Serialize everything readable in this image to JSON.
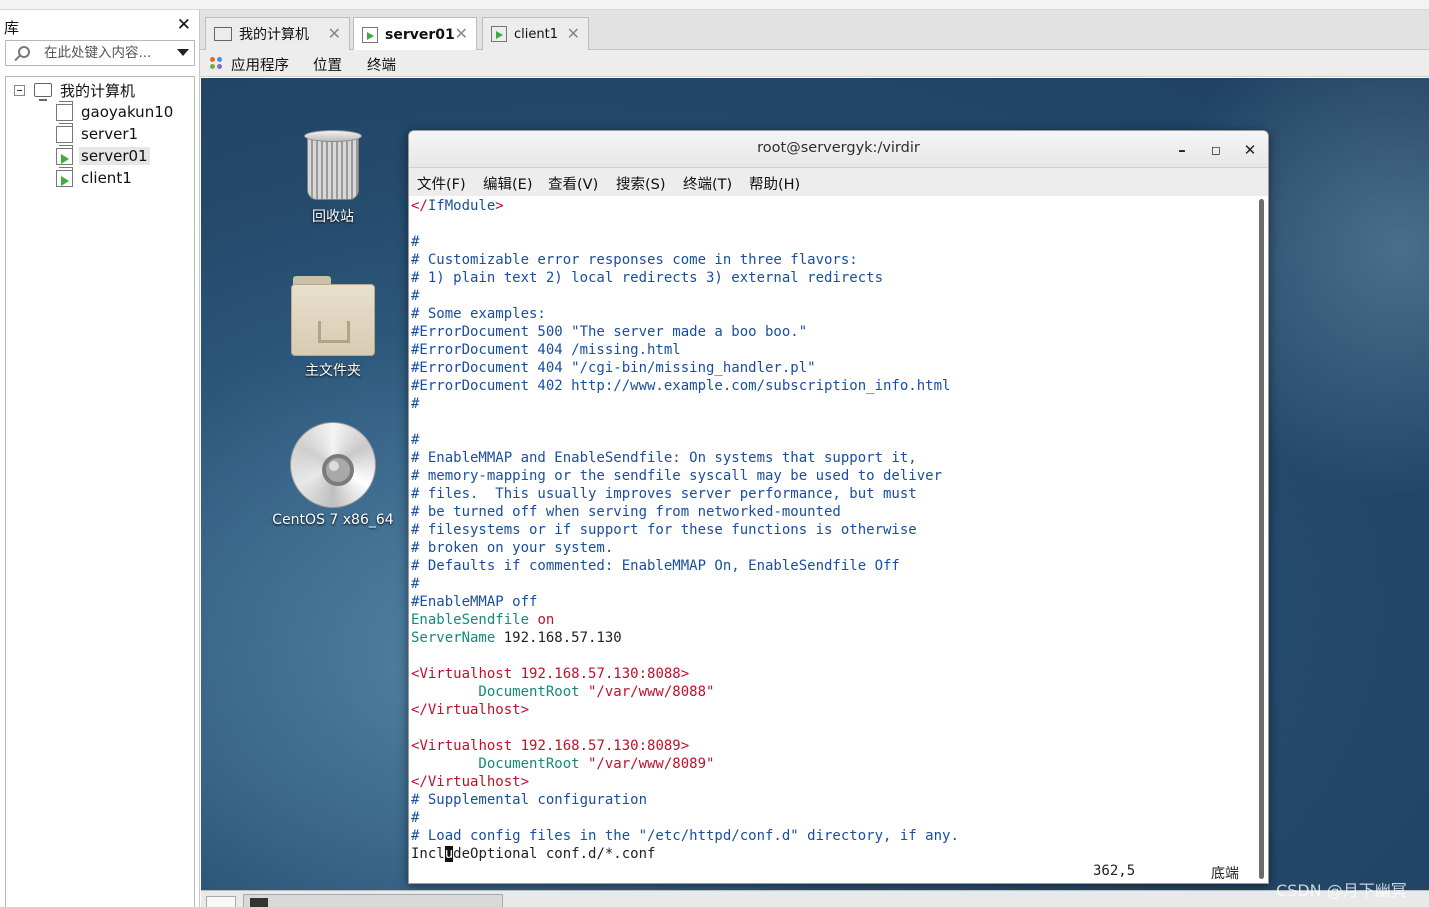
{
  "library": {
    "title": "库",
    "close_glyph": "✕",
    "search_placeholder": "在此处键入内容...",
    "tree": {
      "root": "我的计算机",
      "items": [
        {
          "label": "gaoyakun10",
          "running": false,
          "selected": false
        },
        {
          "label": "server1",
          "running": false,
          "selected": false
        },
        {
          "label": "server01",
          "running": true,
          "selected": true
        },
        {
          "label": "client1",
          "running": true,
          "selected": false
        }
      ]
    }
  },
  "tabs": [
    {
      "label": "我的计算机",
      "icon": "computer-icon",
      "active": false
    },
    {
      "label": "server01",
      "icon": "vm-running-icon",
      "active": true
    },
    {
      "label": "client1",
      "icon": "vm-running-icon",
      "active": false
    }
  ],
  "gnome_menu": {
    "applications": "应用程序",
    "places": "位置",
    "terminal": "终端"
  },
  "desktop_icons": {
    "trash": "回收站",
    "home": "主文件夹",
    "disc": "CentOS 7 x86_64"
  },
  "terminal": {
    "title": "root@servergyk:/virdir",
    "menu": [
      "文件(F)",
      "编辑(E)",
      "查看(V)",
      "搜索(S)",
      "终端(T)",
      "帮助(H)"
    ],
    "lines": {
      "l01a": "</",
      "l01b": "IfModule",
      "l01c": ">",
      "l03": "#",
      "l04": "# Customizable error responses come in three flavors:",
      "l05": "# 1) plain text 2) local redirects 3) external redirects",
      "l06": "#",
      "l07": "# Some examples:",
      "l08": "#ErrorDocument 500 \"The server made a boo boo.\"",
      "l09": "#ErrorDocument 404 /missing.html",
      "l10": "#ErrorDocument 404 \"/cgi-bin/missing_handler.pl\"",
      "l11": "#ErrorDocument 402 http://www.example.com/subscription_info.html",
      "l12": "#",
      "l14": "#",
      "l15": "# EnableMMAP and EnableSendfile: On systems that support it,",
      "l16": "# memory-mapping or the sendfile syscall may be used to deliver",
      "l17": "# files.  This usually improves server performance, but must",
      "l18": "# be turned off when serving from networked-mounted",
      "l19": "# filesystems or if support for these functions is otherwise",
      "l20": "# broken on your system.",
      "l21": "# Defaults if commented: EnableMMAP On, EnableSendfile Off",
      "l22": "#",
      "l23": "#EnableMMAP off",
      "l24a": "EnableSendfile",
      "l24b": " on",
      "l25a": "ServerName",
      "l25b": " 192.168.57.130",
      "l27a": "<",
      "l27b": "Virtualhost 192.168.57.130:8088",
      "l27c": ">",
      "l28a": "        DocumentRoot",
      "l28b": " \"/var/www/8088\"",
      "l29a": "</",
      "l29b": "Virtualhost",
      "l29c": ">",
      "l31a": "<",
      "l31b": "Virtualhost 192.168.57.130:8089",
      "l31c": ">",
      "l32a": "        DocumentRoot",
      "l32b": " \"/var/www/8089\"",
      "l33a": "</",
      "l33b": "Virtualhost",
      "l33c": ">",
      "l34": "# Supplemental configuration",
      "l35": "#",
      "l36": "# Load config files in the \"/etc/httpd/conf.d\" directory, if any.",
      "l37a": "Incl",
      "l37b": "u",
      "l37c": "deOptional conf.d/*.conf"
    },
    "status_position": "362,5",
    "status_where": "底端"
  },
  "watermark": "CSDN @月下幽冥"
}
